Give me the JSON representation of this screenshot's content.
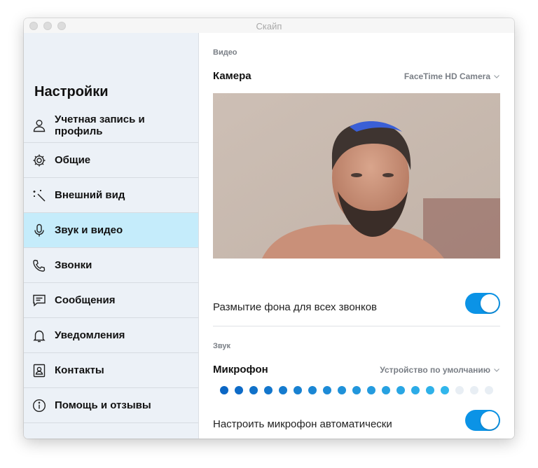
{
  "window": {
    "title": "Скайп"
  },
  "sidebar": {
    "title": "Настройки",
    "items": [
      {
        "label": "Учетная запись и профиль",
        "icon": "person-icon",
        "active": false
      },
      {
        "label": "Общие",
        "icon": "gear-icon",
        "active": false
      },
      {
        "label": "Внешний вид",
        "icon": "magic-wand-icon",
        "active": false
      },
      {
        "label": "Звук и видео",
        "icon": "microphone-icon",
        "active": true
      },
      {
        "label": "Звонки",
        "icon": "phone-icon",
        "active": false
      },
      {
        "label": "Сообщения",
        "icon": "chat-icon",
        "active": false
      },
      {
        "label": "Уведомления",
        "icon": "bell-icon",
        "active": false
      },
      {
        "label": "Контакты",
        "icon": "contacts-icon",
        "active": false
      },
      {
        "label": "Помощь и отзывы",
        "icon": "info-icon",
        "active": false
      }
    ]
  },
  "main": {
    "video_section": {
      "label": "Видео",
      "camera_title": "Камера",
      "camera_device": "FaceTime HD Camera",
      "blur_label": "Размытие фона для всех звонков",
      "blur_enabled": true
    },
    "audio_section": {
      "label": "Звук",
      "mic_title": "Микрофон",
      "mic_device": "Устройство по умолчанию",
      "mic_level_active": 16,
      "mic_level_total": 19,
      "auto_mic_label": "Настроить микрофон автоматически",
      "auto_mic_enabled": true
    }
  },
  "colors": {
    "accent": "#0b93e6",
    "active_item": "#c5ecfb",
    "sidebar_bg": "#ecf1f7"
  }
}
